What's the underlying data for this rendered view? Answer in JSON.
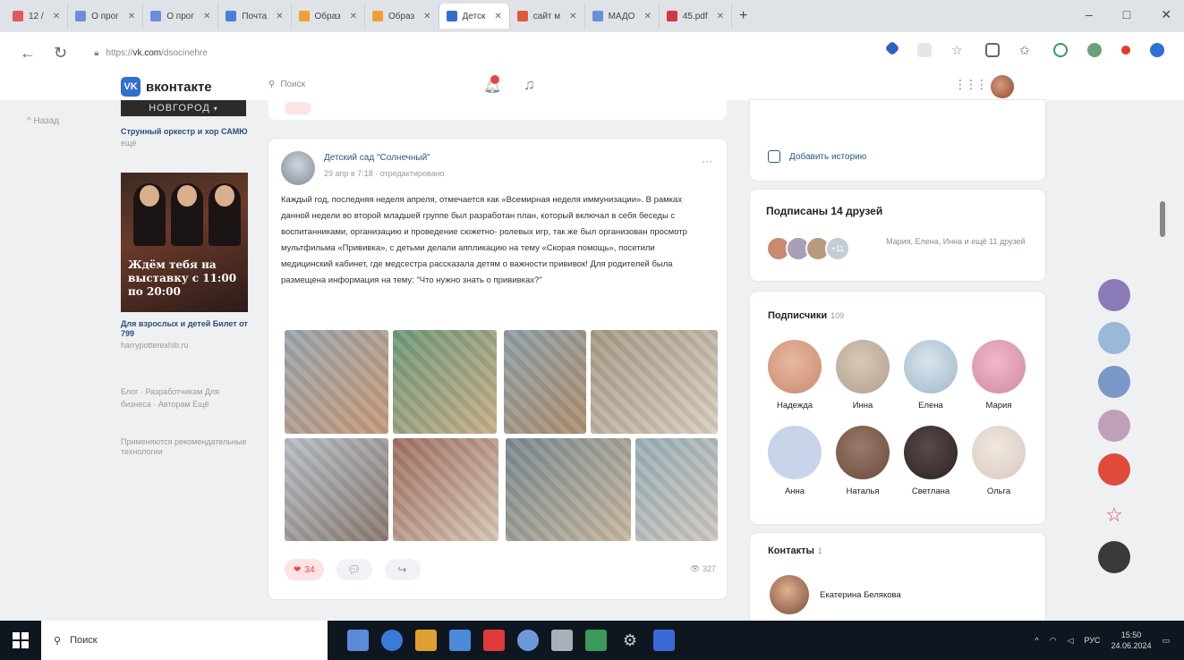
{
  "browser": {
    "tabs": [
      {
        "label": "12 /",
        "color": "#e05a5a"
      },
      {
        "label": "О прог",
        "color": "#6a8fd8"
      },
      {
        "label": "О прог",
        "color": "#6a8fd8"
      },
      {
        "label": "Почта",
        "color": "#4a7fd6"
      },
      {
        "label": "Образ",
        "color": "#f0a030"
      },
      {
        "label": "Образ",
        "color": "#f0a030"
      },
      {
        "label": "Детск",
        "color": "#2f6fcf"
      },
      {
        "label": "сайт м",
        "color": "#e05a3a"
      },
      {
        "label": "МАДО",
        "color": "#6a8fd8"
      },
      {
        "label": "45.pdf",
        "color": "#d03a3a"
      }
    ],
    "new_tab": "+",
    "url_prefix": "https://",
    "url_domain": "vk.com",
    "url_path": "/dsocinehre",
    "window_controls": [
      "–",
      "□",
      "✕"
    ]
  },
  "vk": {
    "logo_text": "вконтакте",
    "logo_mark": "VK",
    "search_placeholder": "Поиск",
    "left_menu_item": "Назад"
  },
  "left_column": {
    "banner": "НОВГОРОД",
    "item1_title": "Струнный оркестр и хор САМЮ",
    "item1_sub": "ещё",
    "poster_text": "Ждём тебя на выставку с 11:00 по 20:00",
    "ad_title": "Для взрослых и детей Билет от 799",
    "ad_sub": "harrypotterexhib.ru",
    "links": "Блог · Разработчикам Для бизнеса · Авторам Ещё",
    "links2": "Применяются рекомендательные технологии"
  },
  "post": {
    "author": "Детский сад \"Солнечный\"",
    "meta": "29 апр в 7:18 · отредактировано",
    "more": "···",
    "text": "Каждый год, последняя неделя апреля, отмечается как «Всемирная неделя иммунизации». В рамках данной недели во второй младшей группе был разработан план, который включал в себя беседы с воспитанниками, организацию и проведение сюжетно- ролевых игр, так же был организован просмотр мультфильма «Прививка», с детьми делали аппликацию на тему «Скорая помощь», посетили медицинский кабинет, где медсестра рассказала детям о важности прививок! Для родителей была размещена информация на тему: \"Что нужно знать о прививках?\"",
    "likes": "34",
    "views": "327",
    "photos": [
      {
        "color1": "#9aa7b0",
        "color2": "#c89a78"
      },
      {
        "color1": "#6f9a7a",
        "color2": "#c8b08a"
      },
      {
        "color1": "#8fa0a8",
        "color2": "#b0906e"
      },
      {
        "color1": "#a89a88",
        "color2": "#d8d0c0"
      },
      {
        "color1": "#b8c0c8",
        "color2": "#8a7a70"
      },
      {
        "color1": "#a07060",
        "color2": "#d8c8b8"
      },
      {
        "color1": "#7a8a90",
        "color2": "#c8b8a0"
      },
      {
        "color1": "#9ab0b8",
        "color2": "#d0c8c0"
      }
    ]
  },
  "right": {
    "add_story": "Добавить историю",
    "friends_title": "Подписаны 14 друзей",
    "friends_more": "+11",
    "friends_names": "Мария, Елена, Инна и ещё 11 друзей",
    "subscribers_title": "Подписчики",
    "subscribers_count": "109",
    "subscribers": [
      {
        "name": "Надежда",
        "color": "#c98a70"
      },
      {
        "name": "Инна",
        "color": "#b0a090"
      },
      {
        "name": "Елена",
        "color": "#a0b8c8"
      },
      {
        "name": "Мария",
        "color": "#d08aa0"
      },
      {
        "name": "Анна",
        "color": "#c8d4ea"
      },
      {
        "name": "Наталья",
        "color": "#6a4a3a"
      },
      {
        "name": "Светлана",
        "color": "#2a2222"
      },
      {
        "name": "Ольга",
        "color": "#d8c8c0"
      }
    ],
    "contacts_title": "Контакты",
    "contacts_count": "1",
    "contact_name": "Екатерина Белякова"
  },
  "floating_chats": [
    "#8a7ab8",
    "#9ab8d8",
    "#7a98c8",
    "#c0a0b8",
    "#e04a3a",
    "#e04a5a",
    "#3a3a3a"
  ],
  "taskbar": {
    "search_label": "Поиск",
    "lang": "РУС",
    "time": "15:50",
    "date": "24.06.2024",
    "icons": [
      "#5a8ad8",
      "#e0a030",
      "#4a8ad8",
      "#e03a3a",
      "#6a9ad8",
      "#aab0b8",
      "#3a9a5a",
      "#cccccc",
      "#3a6ad8"
    ]
  }
}
